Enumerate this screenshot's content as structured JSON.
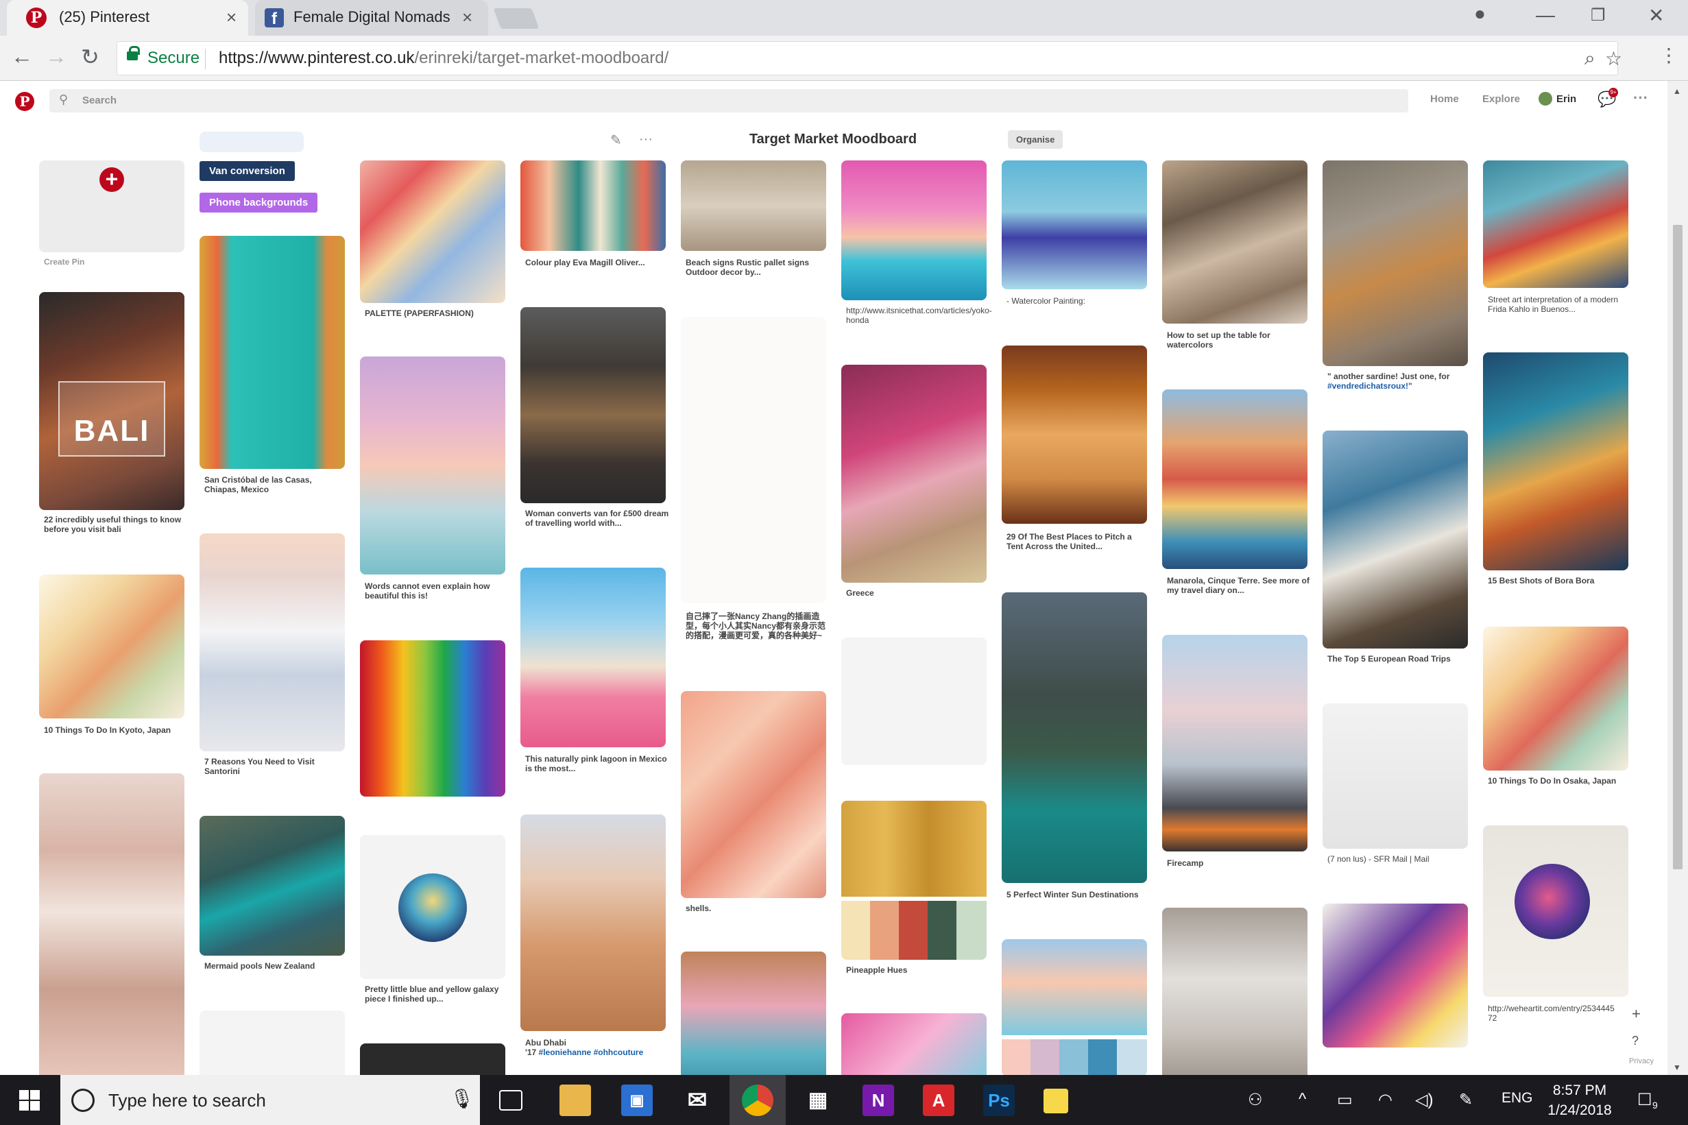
{
  "browser": {
    "tabs": [
      {
        "title": "(25) Pinterest"
      },
      {
        "title": "Female Digital Nomads"
      }
    ],
    "security_label": "Secure",
    "url_host": "https://www.pinterest.co.uk",
    "url_path": "/erinreki/target-market-moodboard/"
  },
  "header": {
    "search_placeholder": "Search",
    "nav_home": "Home",
    "nav_explore": "Explore",
    "user_name": "Erin",
    "notifications_badge": "9+"
  },
  "board": {
    "title": "Target Market Moodboard",
    "organise_label": "Organise",
    "create_pin_label": "Create Pin",
    "sections": [
      "Van conversion",
      "Phone backgrounds"
    ],
    "image_overlay_text": "BALI"
  },
  "pins": {
    "c1_a": "22 incredibly useful things to know before you visit bali",
    "c1_b": "10 Things To Do In Kyoto, Japan",
    "c2_a": "San Cristóbal de las Casas, Chiapas, Mexico",
    "c2_b": "7 Reasons You Need to Visit Santorini",
    "c2_c": "Mermaid pools New Zealand",
    "c3_a": "PALETTE (PAPERFASHION)",
    "c3_b": "Words cannot even explain how beautiful this is!",
    "c3_c": "Pretty little blue and yellow galaxy piece I finished up...",
    "c4_a": "Colour play Eva Magill Oliver...",
    "c4_b": "Woman converts van for £500 dream of travelling world with...",
    "c4_c": "This naturally pink lagoon in Mexico is the most...",
    "c4_d1": "Abu Dhabi",
    "c4_d2": "'17",
    "c4_d3": "#leoniehanne #ohhcouture",
    "c5_a": "Beach signs Rustic pallet signs Outdoor decor by...",
    "c5_b": "自己摔了一张Nancy Zhang的插画造型，每个小人其实Nancy都有亲身示范的搭配，漫画更可爱，真的各种美好~",
    "c5_c": "shells.",
    "c6_a": "http://www.itsnicethat.com/articles/yoko-honda",
    "c6_b": "Greece",
    "c6_c": "Pineapple Hues",
    "c7_a": "- Watercolor Painting:",
    "c7_b": "29 Of The Best Places to Pitch a Tent Across the United...",
    "c7_c": "5 Perfect Winter Sun Destinations",
    "c8_a": "How to set up the table for watercolors",
    "c8_b": "Manarola, Cinque Terre. See more of my travel diary on...",
    "c8_c": "Firecamp",
    "c9_a1": "\" another sardine! Just one, for",
    "c9_a2": "#vendredichatsroux!\"",
    "c9_b": "The Top 5 European Road Trips",
    "c9_c": "(7 non lus) - SFR Mail | Mail",
    "c10_a": "Street art interpretation of a modern Frida Kahlo in Buenos...",
    "c10_b": "15 Best Shots of Bora Bora",
    "c10_c": "10 Things To Do In Osaka, Japan",
    "c10_d": "http://weheartit.com/entry/253444572"
  },
  "sidebar": {
    "privacy": "Privacy"
  },
  "taskbar": {
    "search_placeholder": "Type here to search",
    "language": "ENG",
    "time": "8:57 PM",
    "date": "1/24/2018",
    "notification_count": "9"
  }
}
